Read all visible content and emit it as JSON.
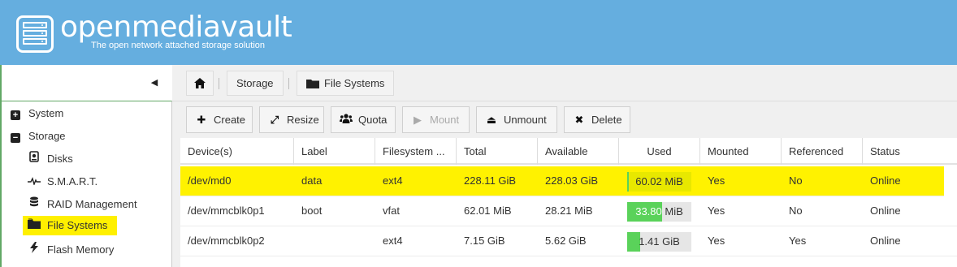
{
  "header": {
    "app_name": "openmediavault",
    "tagline": "The open network attached storage solution",
    "brand_color": "#65aedf"
  },
  "sidebar": {
    "collapse_icon": "chevron-left-icon",
    "items": [
      {
        "label": "System",
        "icon": "plus-square-icon",
        "expanded": false
      },
      {
        "label": "Storage",
        "icon": "minus-square-icon",
        "expanded": true
      },
      {
        "label": "Disks",
        "icon": "hdd-icon"
      },
      {
        "label": "S.M.A.R.T.",
        "icon": "heartbeat-icon"
      },
      {
        "label": "RAID Management",
        "icon": "database-icon"
      },
      {
        "label": "File Systems",
        "icon": "folder-icon",
        "selected": true
      },
      {
        "label": "Flash Memory",
        "icon": "bolt-icon"
      }
    ]
  },
  "breadcrumb": {
    "home_icon": "home-icon",
    "items": [
      {
        "label": "Storage"
      },
      {
        "label": "File Systems",
        "icon": "folder-icon"
      }
    ]
  },
  "toolbar": {
    "buttons": [
      {
        "label": "Create",
        "icon": "plus-icon",
        "enabled": true
      },
      {
        "label": "Resize",
        "icon": "expand-icon",
        "enabled": true
      },
      {
        "label": "Quota",
        "icon": "users-icon",
        "enabled": true
      },
      {
        "label": "Mount",
        "icon": "play-icon",
        "enabled": false
      },
      {
        "label": "Unmount",
        "icon": "eject-icon",
        "enabled": true
      },
      {
        "label": "Delete",
        "icon": "close-icon",
        "enabled": true
      }
    ]
  },
  "grid": {
    "columns": [
      "Device(s)",
      "Label",
      "Filesystem ...",
      "Total",
      "Available",
      "Used",
      "Mounted",
      "Referenced",
      "Status"
    ],
    "rows": [
      {
        "device": "/dev/md0",
        "label": "data",
        "fs": "ext4",
        "total": "228.11 GiB",
        "available": "228.03 GiB",
        "used": "60.02 MiB",
        "used_fraction": 0.01,
        "used_white": "",
        "used_rest": "60.02 MiB",
        "mounted": "Yes",
        "referenced": "No",
        "status": "Online",
        "highlighted": true
      },
      {
        "device": "/dev/mmcblk0p1",
        "label": "boot",
        "fs": "vfat",
        "total": "62.01 MiB",
        "available": "28.21 MiB",
        "used": "33.80 MiB",
        "used_fraction": 0.55,
        "used_white": "33.80",
        "used_rest": " MiB",
        "mounted": "Yes",
        "referenced": "No",
        "status": "Online",
        "highlighted": false
      },
      {
        "device": "/dev/mmcblk0p2",
        "label": "",
        "fs": "ext4",
        "total": "7.15 GiB",
        "available": "5.62 GiB",
        "used": "1.41 GiB",
        "used_fraction": 0.2,
        "used_white": "",
        "used_rest": "1.41 GiB",
        "mounted": "Yes",
        "referenced": "Yes",
        "status": "Online",
        "highlighted": false
      }
    ],
    "usage_color": "#5ad25a"
  }
}
